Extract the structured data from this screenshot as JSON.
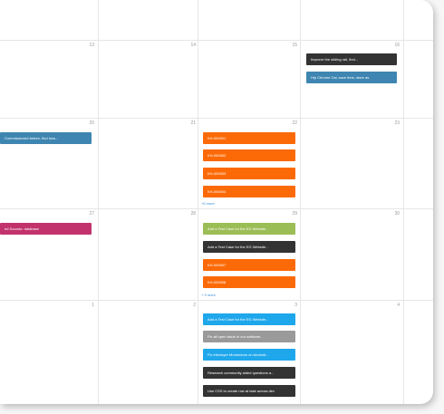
{
  "colors": {
    "dark": "#333333",
    "steel_blue": "#3e86b1",
    "orange": "#fc6a07",
    "magenta": "#c2336e",
    "lime": "#9bbd55",
    "sky": "#1fa7eb",
    "gray": "#9a9a9a",
    "link": "#3a8fd6"
  },
  "days": {
    "d13": "13",
    "d14": "14",
    "d15": "15",
    "d16": "16",
    "d20": "20",
    "d21": "21",
    "d22": "22",
    "d23": "23",
    "d27": "27",
    "d28": "28",
    "d29": "29",
    "d30": "30",
    "n1": "1",
    "n2": "2",
    "n3": "3",
    "n4": "4"
  },
  "events": {
    "e16a": "Improve the sliding rail, find...",
    "e16b": "Hip Chrome Cal, save time, store as",
    "e20a": "Commissioned before, find how...",
    "e22a": "KH-000001",
    "e22b": "KH-000002",
    "e22c": "KH-000003",
    "e22d": "KH-000004",
    "e27a": "ed Soundo: database",
    "e29a": "Add a Test Case for the EG Website...",
    "e29b": "Add a Test Case for the EG Website...",
    "e29c": "KH-000007",
    "e29d": "KH-000008",
    "n2a": "Add a Test Case for the EG Website...",
    "n2b": "Fix all open issue in our software...",
    "n2c": "Fix interlayer Momentum on Android...",
    "n2d": "Research community aided questions a...",
    "n2e": "Use CSS to create row at task across dev"
  },
  "more_links": {
    "m22": "+6 more",
    "m29": "+ 9 more"
  }
}
